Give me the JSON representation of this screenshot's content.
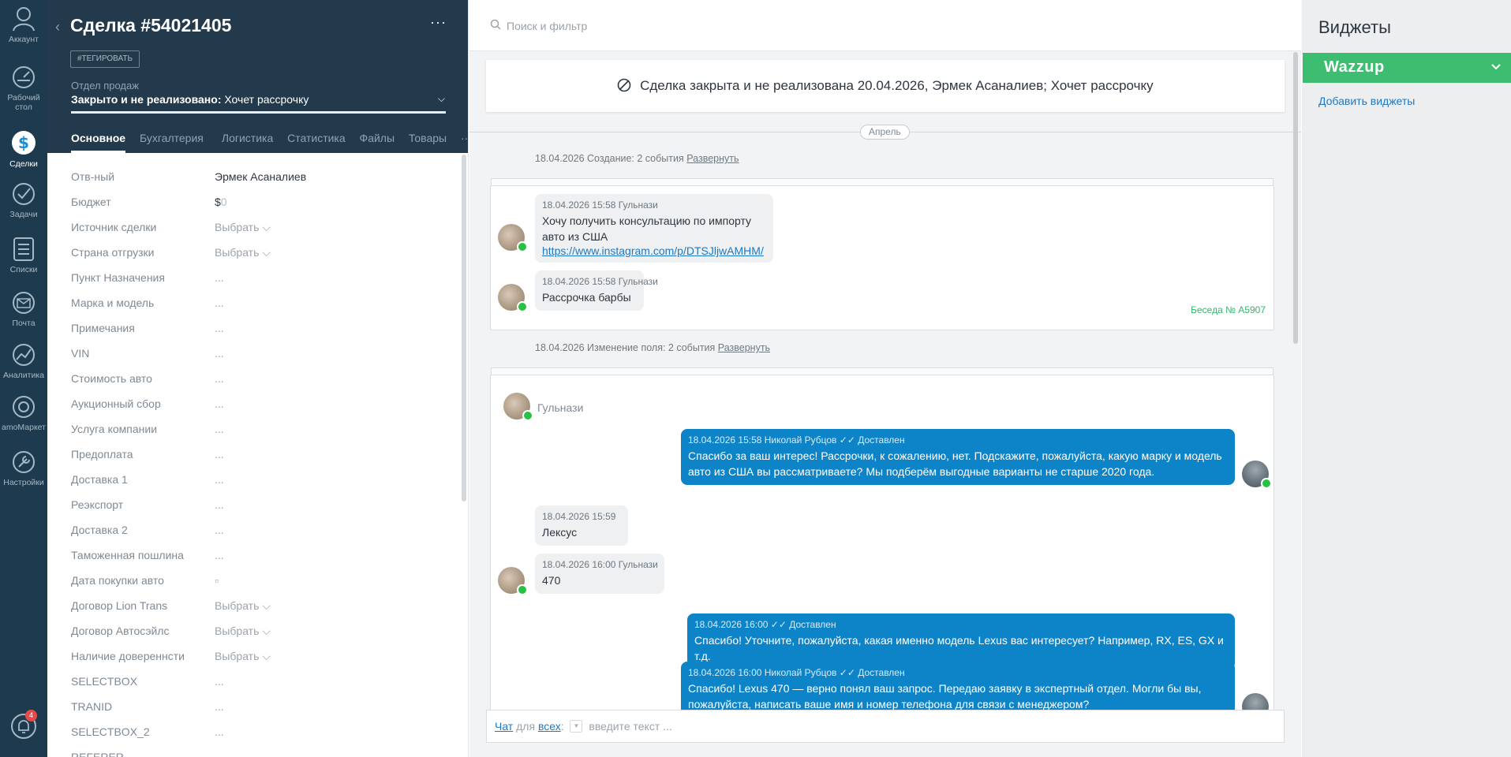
{
  "nav": {
    "items": [
      {
        "label": "Аккаунт",
        "icon": "account-icon"
      },
      {
        "label": "Рабочий стол",
        "icon": "dashboard-icon"
      },
      {
        "label": "Сделки",
        "icon": "deals-icon"
      },
      {
        "label": "Задачи",
        "icon": "tasks-icon"
      },
      {
        "label": "Списки",
        "icon": "lists-icon"
      },
      {
        "label": "Почта",
        "icon": "mail-icon"
      },
      {
        "label": "Аналитика",
        "icon": "analytics-icon"
      },
      {
        "label": "amoМаркет",
        "icon": "market-icon"
      },
      {
        "label": "Настройки",
        "icon": "settings-icon"
      }
    ],
    "notifications_count": "4"
  },
  "deal": {
    "title": "Сделка #54021405",
    "tag_button": "#ТЕГИРОВАТЬ",
    "pipeline_label": "Отдел продаж",
    "status_bold": "Закрыто и не реализовано:",
    "status_reason": "Хочет рассрочку",
    "tabs": [
      "Основное",
      "Бухгалтерия",
      "Логистика",
      "Статистика",
      "Файлы",
      "Товары"
    ],
    "tabs_more": "···",
    "fields": [
      {
        "label": "Отв-ный",
        "value": "Эрмек Асаналиев"
      },
      {
        "label": "Бюджет",
        "value": "$",
        "value_gray": "0"
      },
      {
        "label": "Источник сделки",
        "value": "Выбрать ⌵"
      },
      {
        "label": "Страна отгрузки",
        "value": "Выбрать ⌵"
      },
      {
        "label": "Пункт Назначения",
        "value": "..."
      },
      {
        "label": "Марка и модель",
        "value": "..."
      },
      {
        "label": "Примечания",
        "value": "..."
      },
      {
        "label": "VIN",
        "value": "..."
      },
      {
        "label": "Стоимость авто",
        "value": "..."
      },
      {
        "label": "Аукционный сбор",
        "value": "..."
      },
      {
        "label": "Услуга компании",
        "value": "..."
      },
      {
        "label": "Предоплата",
        "value": "..."
      },
      {
        "label": "Доставка 1",
        "value": "..."
      },
      {
        "label": "Реэкспорт",
        "value": "..."
      },
      {
        "label": "Доставка 2",
        "value": "..."
      },
      {
        "label": "Таможенная пошлина",
        "value": "..."
      },
      {
        "label": "Дата покупки авто",
        "value": "▫"
      },
      {
        "label": "Договор Lion Trans",
        "value": "Выбрать ⌵"
      },
      {
        "label": "Договор Автосэйлс",
        "value": "Выбрать ⌵"
      },
      {
        "label": "Наличие довереннсти",
        "value": "Выбрать ⌵"
      },
      {
        "label": "SELECTBOX",
        "value": "..."
      },
      {
        "label": "TRANID",
        "value": "..."
      },
      {
        "label": "SELECTBOX_2",
        "value": "..."
      },
      {
        "label": "REFERER",
        "value": "..."
      }
    ]
  },
  "feed": {
    "search_placeholder": "Поиск и фильтр",
    "banner": "Сделка закрыта и не реализована 20.04.2026, Эрмек Асаналиев; Хочет рассрочку",
    "month": "Апрель",
    "event1_text": "18.04.2026 Создание: 2 события",
    "event2_text": "18.04.2026 Изменение поля: 2 события",
    "expand_link": "Развернуть",
    "msg1_meta": "18.04.2026 15:58 Гульнази",
    "msg1_text": "Хочу получить консультацию по импорту авто из США",
    "msg1_link": "https://www.instagram.com/p/DTSJljwAMHM/",
    "msg2_meta": "18.04.2026 15:58 Гульнази",
    "msg2_text": "Рассрочка барбы",
    "conversation_id": "Беседа № A5907",
    "chat_sender": "Гульнази",
    "out1_meta": "18.04.2026 15:58 Николай Рубцов",
    "out1_status": "Доставлен",
    "out1_text": "Спасибо за ваш интерес! Рассрочки, к сожалению, нет. Подскажите, пожалуйста, какую марку и модель авто из США вы рассматриваете? Мы подберём выгодные варианты не старше 2020 года.",
    "in3_meta": "18.04.2026 15:59",
    "in3_text": "Лексус",
    "in4_meta": "18.04.2026 16:00 Гульнази",
    "in4_text": "470",
    "out2_meta": "18.04.2026 16:00",
    "out2_status": "Доставлен",
    "out2_text": "Спасибо! Уточните, пожалуйста, какая именно модель Lexus вас интересует? Например, RX, ES, GX и т.д.",
    "out3_meta": "18.04.2026 16:00 Николай Рубцов",
    "out3_status": "Доставлен",
    "out3_text": "Спасибо! Lexus 470 — верно понял ваш запрос. Передаю заявку в экспертный отдел. Могли бы вы, пожалуйста, написать ваше имя и номер телефона для связи с менеджером?",
    "composer_chat": "Чат",
    "composer_for": "для",
    "composer_all": "всех",
    "composer_placeholder": "введите текст ..."
  },
  "widgets": {
    "title": "Виджеты",
    "widget_name": "Wazzup",
    "add_link": "Добавить виджеты"
  },
  "colors": {
    "nav_bg": "#1d3a4e",
    "header_bg": "#223a4b",
    "outgoing_bubble": "#0e84c8",
    "widget_green": "#3dbd6f",
    "whatsapp_green": "#27c143"
  }
}
